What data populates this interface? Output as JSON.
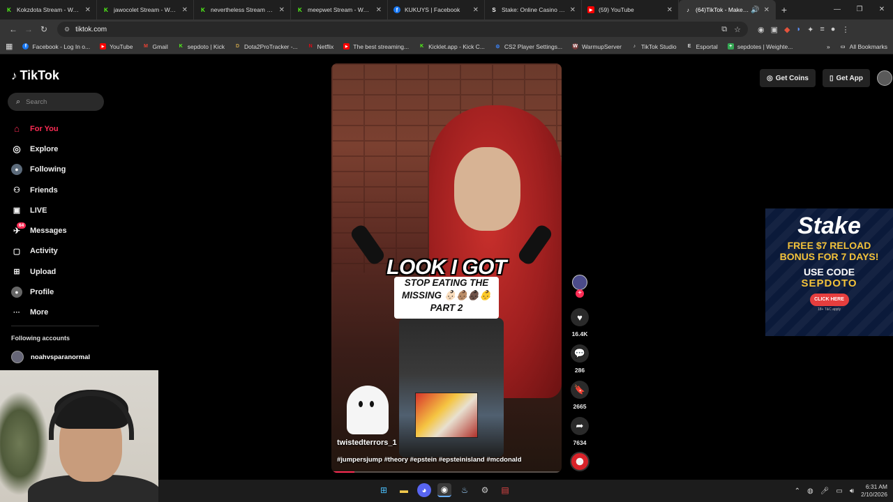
{
  "browser": {
    "tabs": [
      {
        "title": "Kokzdota Stream - Watch",
        "favicon": "kick-icon",
        "color": "#53fc18",
        "glyph": "K"
      },
      {
        "title": "jawocolet Stream - Watch",
        "favicon": "kick-icon",
        "color": "#53fc18",
        "glyph": "K"
      },
      {
        "title": "nevertheless Stream - Wa",
        "favicon": "kick-icon",
        "color": "#53fc18",
        "glyph": "K"
      },
      {
        "title": "meepwet Stream - Watch",
        "favicon": "kick-icon",
        "color": "#53fc18",
        "glyph": "K"
      },
      {
        "title": "KUKUYS | Facebook",
        "favicon": "facebook-icon",
        "color": "#1877f2",
        "glyph": "f"
      },
      {
        "title": "Stake: Online Casino & Sp",
        "favicon": "stake-icon",
        "color": "#ffffff",
        "glyph": "S"
      },
      {
        "title": "(59) YouTube",
        "favicon": "youtube-icon",
        "color": "#ff0000",
        "glyph": "▶"
      },
      {
        "title": "(64)TikTok - Make You",
        "favicon": "tiktok-icon",
        "color": "#ffffff",
        "glyph": "♪"
      }
    ],
    "url": "tiktok.com",
    "bookmarks": [
      {
        "label": "Facebook - Log In o...",
        "color": "#1877f2",
        "glyph": "f"
      },
      {
        "label": "YouTube",
        "color": "#ff0000",
        "glyph": "▶"
      },
      {
        "label": "Gmail",
        "color": "#ea4335",
        "glyph": "M"
      },
      {
        "label": "sepdoto | Kick",
        "color": "#53fc18",
        "glyph": "K"
      },
      {
        "label": "Dota2ProTracker -...",
        "color": "#c8a24a",
        "glyph": "D"
      },
      {
        "label": "Netflix",
        "color": "#e50914",
        "glyph": "N"
      },
      {
        "label": "The best streaming...",
        "color": "#ff0000",
        "glyph": "▶"
      },
      {
        "label": "Kicklet.app - Kick C...",
        "color": "#53fc18",
        "glyph": "K"
      },
      {
        "label": "CS2 Player Settings...",
        "color": "#3b82f6",
        "glyph": "⚙"
      },
      {
        "label": "WarmupServer",
        "color": "#7a3b3b",
        "glyph": "W"
      },
      {
        "label": "TikTok Studio",
        "color": "#ffffff",
        "glyph": "♪"
      },
      {
        "label": "Esportal",
        "color": "#444444",
        "glyph": "E"
      },
      {
        "label": "sepdotes | Weighte...",
        "color": "#34a853",
        "glyph": "+"
      }
    ],
    "all_bookmarks": "All Bookmarks"
  },
  "tiktok": {
    "logo": "TikTok",
    "search_placeholder": "Search",
    "nav": [
      {
        "label": "For You",
        "icon": "home-icon",
        "glyph": "⌂"
      },
      {
        "label": "Explore",
        "icon": "compass-icon",
        "glyph": "◎"
      },
      {
        "label": "Following",
        "icon": "following-avatar-icon",
        "glyph": "●"
      },
      {
        "label": "Friends",
        "icon": "friends-icon",
        "glyph": "👥"
      },
      {
        "label": "LIVE",
        "icon": "live-icon",
        "glyph": "▣"
      },
      {
        "label": "Messages",
        "icon": "messages-icon",
        "glyph": "✉"
      },
      {
        "label": "Activity",
        "icon": "activity-icon",
        "glyph": "▢"
      },
      {
        "label": "Upload",
        "icon": "upload-icon",
        "glyph": "⊞"
      },
      {
        "label": "Profile",
        "icon": "profile-icon",
        "glyph": "●"
      },
      {
        "label": "More",
        "icon": "more-icon",
        "glyph": "···"
      }
    ],
    "messages_badge": "64",
    "following_accounts_title": "Following accounts",
    "following_account": "noahvsparanormal",
    "get_coins": "Get Coins",
    "get_app": "Get App",
    "video": {
      "overlay_line1": "LOOK I GOT",
      "card_line1": "STOP EATING THE",
      "card_line2": "MISSING 👶🏻👶🏽👶🏿👶",
      "card_line3": "PART 2",
      "creator": "twistedterrors_1",
      "caption": "#jumpersjump #theory #epstein #epsteinisland #mcdonald",
      "progress": 0.1
    },
    "actions": {
      "likes": "16.4K",
      "comments": "286",
      "saves": "2665",
      "shares": "7634"
    },
    "accent": "#fe2c55"
  },
  "ad": {
    "brand": "Stake",
    "line1": "FREE $7 RELOAD",
    "line2": "BONUS FOR 7 DAYS!",
    "use_code": "USE CODE",
    "code": "SEPDOTO",
    "button": "CLICK HERE",
    "fine": "18+ T&C apply"
  },
  "taskbar": {
    "time": "6:31 AM",
    "date": "2/10/2026"
  }
}
